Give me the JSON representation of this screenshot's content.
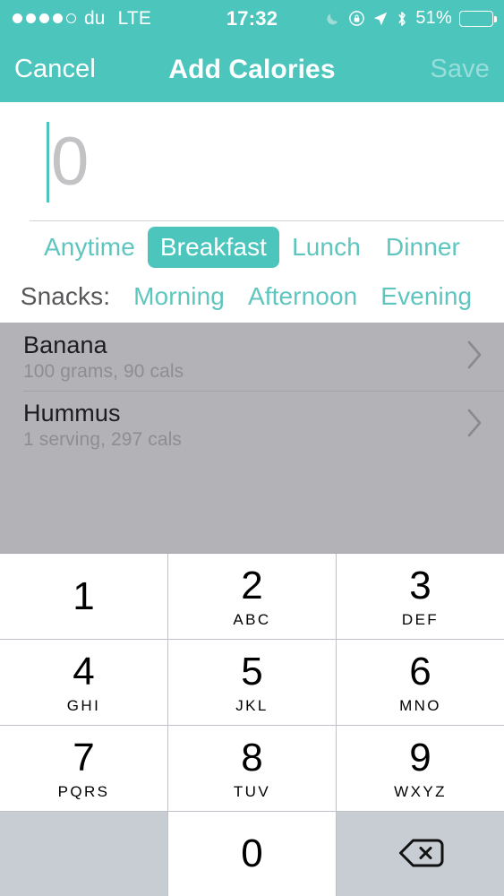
{
  "status_bar": {
    "signal_dots_filled": 4,
    "signal_dots_total": 5,
    "carrier": "du",
    "radio": "LTE",
    "time": "17:32",
    "icons": [
      "moon-icon",
      "rotation-lock-icon",
      "location-arrow-icon",
      "bluetooth-icon"
    ],
    "battery_percent": "51%",
    "battery_level": 51
  },
  "nav": {
    "cancel_label": "Cancel",
    "title": "Add Calories",
    "save_label": "Save",
    "save_enabled": false
  },
  "amount_input": {
    "value": "",
    "placeholder": "0",
    "caret_color": "#4cc5bd"
  },
  "meal_types": [
    {
      "label": "Anytime",
      "selected": false
    },
    {
      "label": "Breakfast",
      "selected": true
    },
    {
      "label": "Lunch",
      "selected": false
    },
    {
      "label": "Dinner",
      "selected": false
    }
  ],
  "snacks": {
    "label": "Snacks:",
    "options": [
      {
        "label": "Morning",
        "selected": false
      },
      {
        "label": "Afternoon",
        "selected": false
      },
      {
        "label": "Evening",
        "selected": false
      }
    ]
  },
  "food_list": [
    {
      "name": "Banana",
      "detail": "100 grams, 90 cals"
    },
    {
      "name": "Hummus",
      "detail": "1 serving, 297 cals"
    }
  ],
  "keypad": {
    "rows": [
      [
        {
          "digit": "1",
          "letters": "",
          "type": "digit"
        },
        {
          "digit": "2",
          "letters": "ABC",
          "type": "digit"
        },
        {
          "digit": "3",
          "letters": "DEF",
          "type": "digit"
        }
      ],
      [
        {
          "digit": "4",
          "letters": "GHI",
          "type": "digit"
        },
        {
          "digit": "5",
          "letters": "JKL",
          "type": "digit"
        },
        {
          "digit": "6",
          "letters": "MNO",
          "type": "digit"
        }
      ],
      [
        {
          "digit": "7",
          "letters": "PQRS",
          "type": "digit"
        },
        {
          "digit": "8",
          "letters": "TUV",
          "type": "digit"
        },
        {
          "digit": "9",
          "letters": "WXYZ",
          "type": "digit"
        }
      ],
      [
        {
          "digit": "",
          "letters": "",
          "type": "blank"
        },
        {
          "digit": "0",
          "letters": "",
          "type": "digit"
        },
        {
          "digit": "",
          "letters": "",
          "type": "backspace"
        }
      ]
    ]
  },
  "colors": {
    "accent_teal": "#4cc5bd",
    "teal_text": "#5ec6be",
    "dimmed_overlay": "#b3b3b7",
    "keypad_bg": "#c8cdd4"
  }
}
